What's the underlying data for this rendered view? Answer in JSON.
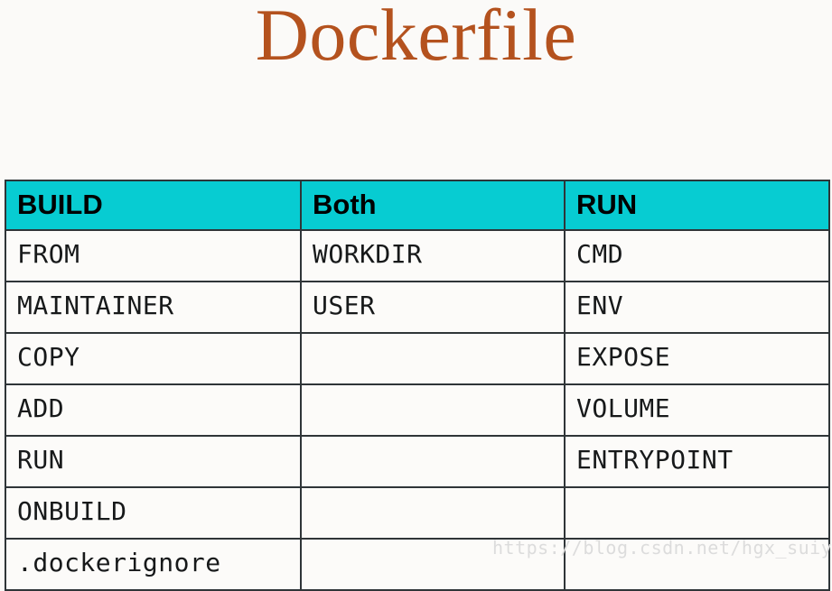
{
  "slide": {
    "title": "Dockerfile",
    "title_color": "#b4521e",
    "background_color": "#fbfaf8"
  },
  "table": {
    "header_background": "#07ccd2",
    "header_text_color": "#000000",
    "border_color": "#2f3538",
    "cell_background": "#fcfbf9",
    "columns": [
      {
        "key": "build",
        "label": "BUILD"
      },
      {
        "key": "both",
        "label": "Both"
      },
      {
        "key": "run",
        "label": "RUN"
      }
    ],
    "rows": [
      {
        "build": "FROM",
        "both": "WORKDIR",
        "run": "CMD"
      },
      {
        "build": "MAINTAINER",
        "both": "USER",
        "run": "ENV"
      },
      {
        "build": "COPY",
        "both": "",
        "run": "EXPOSE"
      },
      {
        "build": "ADD",
        "both": "",
        "run": "VOLUME"
      },
      {
        "build": "RUN",
        "both": "",
        "run": "ENTRYPOINT"
      },
      {
        "build": "ONBUILD",
        "both": "",
        "run": ""
      },
      {
        "build": ".dockerignore",
        "both": "",
        "run": ""
      }
    ]
  },
  "watermark": {
    "text": "https://blog.csdn.net/hgx_suiyuesusu",
    "color": "#dcdcdc"
  }
}
